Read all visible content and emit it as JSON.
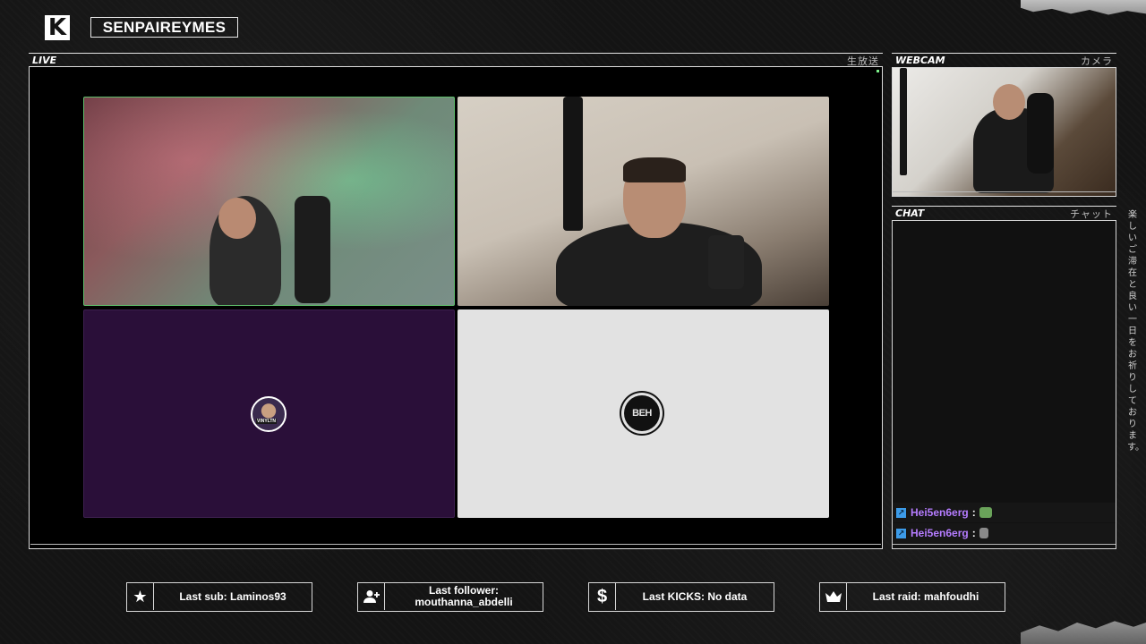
{
  "brand": {
    "logo_letter": "K",
    "channel_name": "SENPAIREYMES"
  },
  "live_panel": {
    "title": "LIVE",
    "jp_label": "生放送"
  },
  "webcam_panel": {
    "title": "WEBCAM",
    "jp_label": "カメラ"
  },
  "chat_panel": {
    "title": "CHAT",
    "jp_label": "チャット",
    "messages": [
      {
        "user": "Hei5en6erg",
        "colon": ":",
        "emote": "pepe-emote"
      },
      {
        "user": "Hei5en6erg",
        "colon": ":",
        "emote": "emote"
      }
    ]
  },
  "video_tiles": [
    {
      "name": "participant-1",
      "avatar_tag": ""
    },
    {
      "name": "participant-2",
      "avatar_tag": ""
    },
    {
      "name": "participant-3",
      "avatar_tag": "VINYLTN"
    },
    {
      "name": "participant-4",
      "logo_text": "BEH"
    }
  ],
  "vertical_note": "楽しいご滞在と良い一日をお祈りしております。",
  "stats": {
    "last_sub": "Last sub: Laminos93",
    "last_follower": "Last follower: mouthanna_abdelli",
    "last_kicks": "Last KICKS: No data",
    "last_raid": "Last raid: mahfoudhi"
  },
  "colors": {
    "accent_green": "#5fbf6b",
    "chat_user": "#b57cff",
    "chat_badge": "#3c9be8",
    "purple_tile": "#2a0f39"
  },
  "icons": {
    "sub": "star-icon",
    "follower": "user-add-icon",
    "kicks": "dollar-icon",
    "raid": "crown-icon"
  }
}
